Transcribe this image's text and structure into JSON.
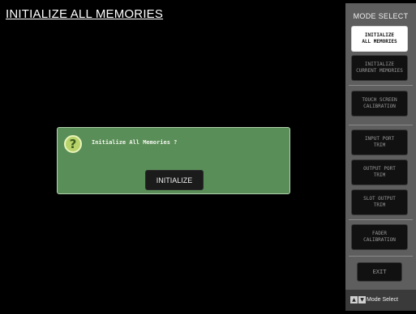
{
  "screen": {
    "title": "INITIALIZE ALL MEMORIES"
  },
  "dialog": {
    "icon": "question-icon",
    "question": "Initialize All Memories ?",
    "button_label": "INITIALIZE",
    "background": "#5a8e58"
  },
  "sidebar": {
    "title": "MODE SELECT",
    "items": [
      {
        "label": "INITIALIZE\nALL MEMORIES",
        "active": true
      },
      {
        "label": "INITIALIZE\nCURRENT MEMORIES",
        "active": false
      },
      {
        "label": "TOUCH SCREEN\nCALIBRATION",
        "active": false
      },
      {
        "label": "INPUT PORT\nTRIM",
        "active": false
      },
      {
        "label": "OUTPUT PORT\nTRIM",
        "active": false
      },
      {
        "label": "SLOT OUTPUT\nTRIM",
        "active": false
      },
      {
        "label": "FADER\nCALIBRATION",
        "active": false
      }
    ],
    "exit_label": "EXIT",
    "footer_label": "Mode Select",
    "footer_icons": [
      "up-arrow-icon",
      "down-arrow-icon"
    ]
  }
}
